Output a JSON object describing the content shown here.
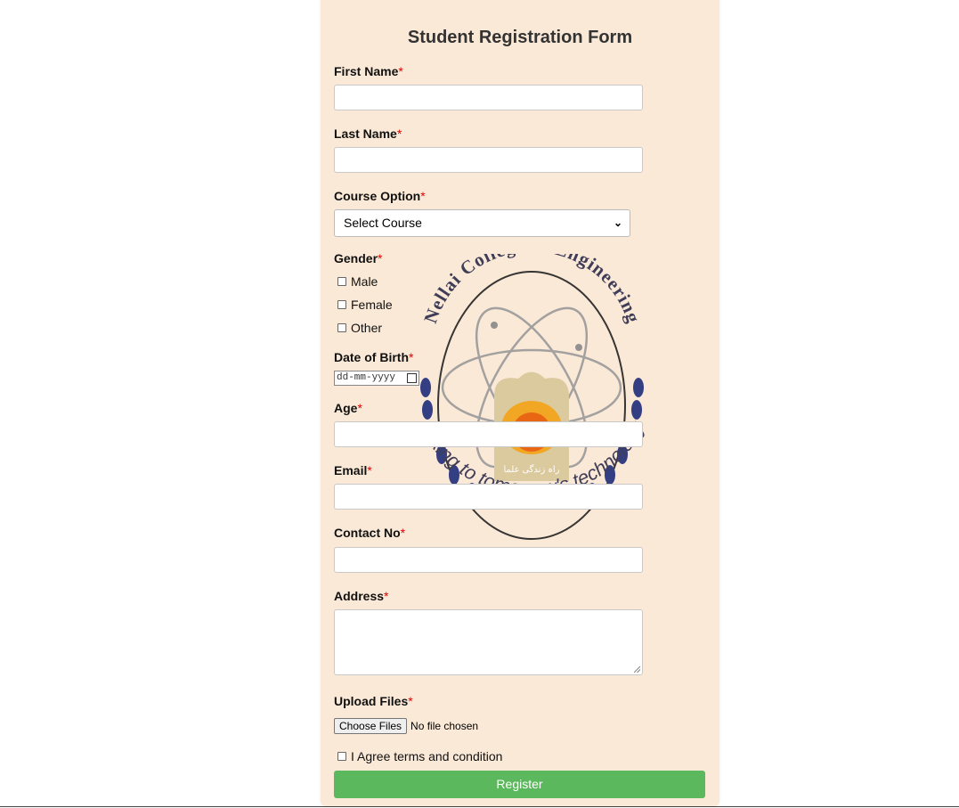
{
  "form": {
    "title": "Student Registration Form",
    "required_mark": "*",
    "first_name_label": "First Name",
    "last_name_label": "Last Name",
    "course_label": "Course Option",
    "course_selected": "Select Course",
    "gender_label": "Gender",
    "gender_options": [
      "Male",
      "Female",
      "Other"
    ],
    "dob_label": "Date of Birth",
    "dob_placeholder": "dd-mm-yyyy",
    "age_label": "Age",
    "email_label": "Email",
    "contact_label": "Contact No",
    "address_label": "Address",
    "upload_label": "Upload Files",
    "choose_files": "Choose Files",
    "no_file": "No file chosen",
    "agree_label": "I Agree terms and condition",
    "register_label": "Register"
  },
  "logo": {
    "top_text": "Nellai College of Engineering",
    "bottom_text": "linking to tomorrow's technology",
    "emblem_text": "راہ زندگی علما"
  },
  "colors": {
    "card_bg": "#fbe9d7",
    "register_bg": "#5cb85c",
    "required": "#e00000"
  }
}
